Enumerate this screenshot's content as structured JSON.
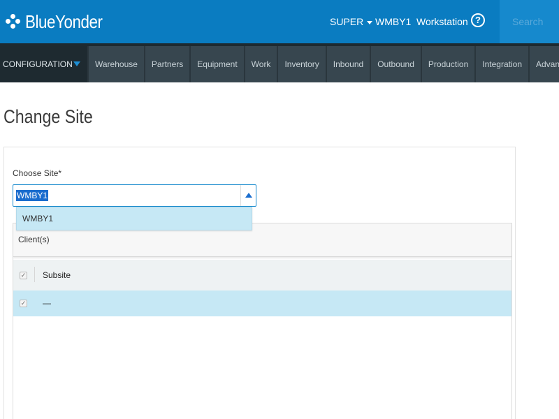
{
  "header": {
    "brand": "BlueYonder",
    "user_menu": "SUPER",
    "site": "WMBY1",
    "workstation": "Workstation",
    "help": "?",
    "search_placeholder": "Search"
  },
  "nav": {
    "config_label": "CONFIGURATION",
    "tabs": [
      "Warehouse",
      "Partners",
      "Equipment",
      "Work",
      "Inventory",
      "Inbound",
      "Outbound",
      "Production",
      "Integration",
      "Advanced"
    ]
  },
  "page": {
    "title": "Change Site"
  },
  "form": {
    "choose_site_label": "Choose Site*",
    "site_value": "WMBY1",
    "dropdown_options": [
      "WMBY1"
    ],
    "clients_label": "Client(s)",
    "grid": {
      "column": "Subsite",
      "rows": [
        "—"
      ]
    }
  },
  "colors": {
    "header_blue": "#0a7cc1",
    "nav_dark": "#2c3a42",
    "row_highlight": "#c6e8f5",
    "accent": "#1a6dce"
  }
}
